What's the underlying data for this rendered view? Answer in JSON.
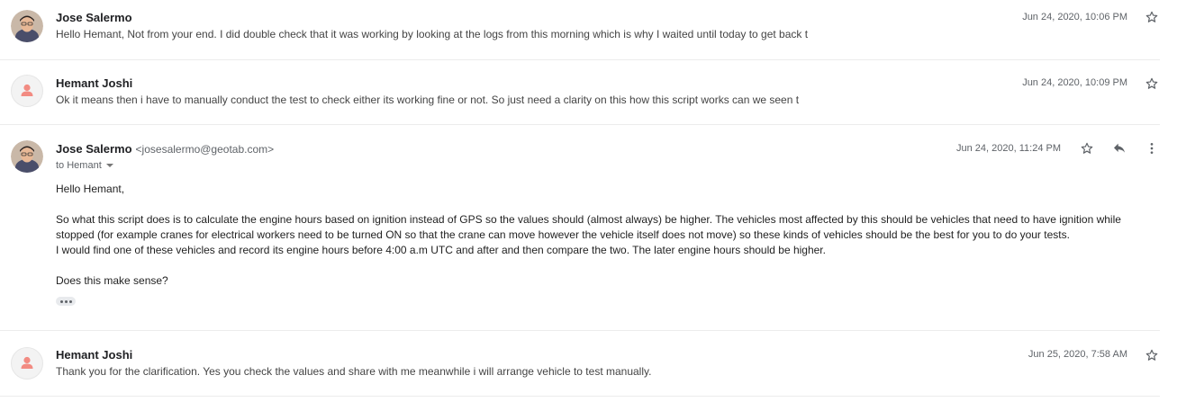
{
  "messages": [
    {
      "sender": "Jose Salermo",
      "snippet": "Hello Hemant, Not from your end. I did double check that it was working by looking at the logs from this morning which is why I waited until today to get back t",
      "date": "Jun 24, 2020, 10:06 PM",
      "avatar": "photo"
    },
    {
      "sender": "Hemant Joshi",
      "snippet": "Ok it means then i have to manually conduct the test to check either its working fine or not. So just need a clarity on this how this script works can we seen t",
      "date": "Jun 24, 2020, 10:09 PM",
      "avatar": "placeholder"
    },
    {
      "sender": "Jose Salermo",
      "email": "<josesalermo@geotab.com>",
      "to": "to Hemant",
      "date": "Jun 24, 2020, 11:24 PM",
      "avatar": "photo",
      "body": {
        "greeting": "Hello Hemant,",
        "para1": "So what this script does is to calculate the engine hours based on ignition instead of GPS so the values should (almost always) be higher. The vehicles most affected by this should be vehicles that need to have ignition while stopped (for example cranes for electrical workers need to be turned ON so that the crane can move however the vehicle itself does not move) so these kinds of vehicles should be the best for you to do your tests.",
        "para2": "I would find one of these vehicles and record its engine hours before 4:00 a.m UTC and after and then compare the two. The later engine hours should be higher.",
        "question": "Does this make sense?"
      }
    },
    {
      "sender": "Hemant Joshi",
      "snippet": "Thank you for the clarification. Yes you check the values and share with me meanwhile i will arrange vehicle to test manually.",
      "date": "Jun 25, 2020, 7:58 AM",
      "avatar": "placeholder"
    }
  ],
  "icons": {
    "star": "star-outline-icon",
    "reply": "reply-icon",
    "more": "more-vert-icon",
    "expand": "show-trimmed-content-icon"
  },
  "colors": {
    "placeholder_avatar": "#f28b82",
    "icon": "#5f6368"
  }
}
